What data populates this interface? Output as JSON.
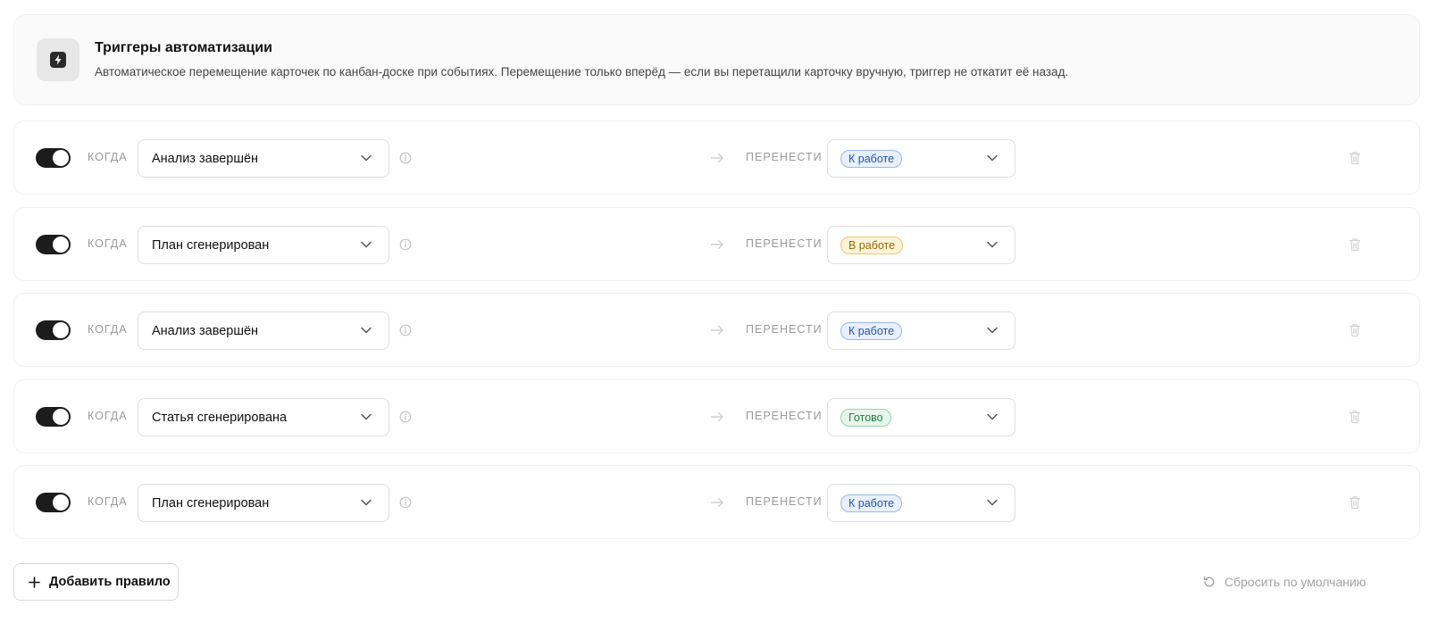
{
  "header": {
    "title": "Триггеры автоматизации",
    "description": "Автоматическое перемещение карточек по канбан-доске при событиях. Перемещение только вперёд — если вы перетащили карточку вручную, триггер не откатит её назад.",
    "icon": "lightning-icon"
  },
  "labels": {
    "when": "КОГДА",
    "move_to": "ПЕРЕНЕСТИ В"
  },
  "status_colors": {
    "К работе": {
      "bg": "#e8f0fe",
      "border": "#9cb7e8",
      "text": "#2354b8"
    },
    "В работе": {
      "bg": "#fdf3d8",
      "border": "#ecc870",
      "text": "#9a6a0c"
    },
    "Готово": {
      "bg": "#e6f6ec",
      "border": "#95d3ac",
      "text": "#23804a"
    }
  },
  "rules": [
    {
      "enabled": true,
      "event": "Анализ завершён",
      "target": "К работе"
    },
    {
      "enabled": true,
      "event": "План сгенерирован",
      "target": "В работе"
    },
    {
      "enabled": true,
      "event": "Анализ завершён",
      "target": "К работе"
    },
    {
      "enabled": true,
      "event": "Статья сгенерирована",
      "target": "Готово"
    },
    {
      "enabled": true,
      "event": "План сгенерирован",
      "target": "К работе"
    }
  ],
  "footer": {
    "add_label": "Добавить правило",
    "reset_label": "Сбросить по умолчанию"
  }
}
